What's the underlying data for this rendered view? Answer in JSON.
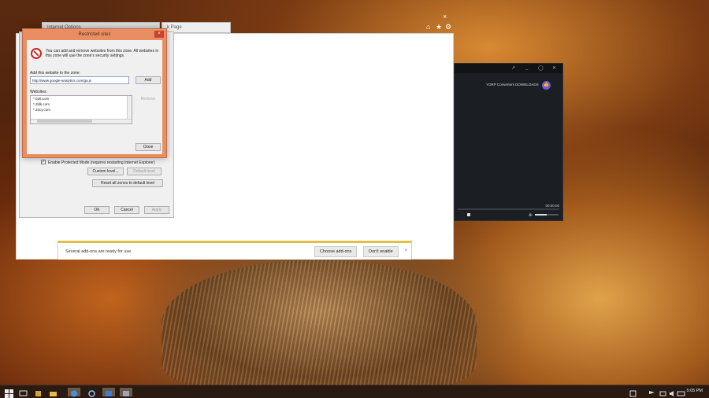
{
  "background_tabs": {
    "tab1_label": "Internet Options",
    "tab2_label": "k Page"
  },
  "browser_controls": {
    "close_glyph": "×",
    "home_glyph": "⌂",
    "star_glyph": "★",
    "gear_glyph": "⚙"
  },
  "notification": {
    "message": "Several add-ons are ready for use.",
    "choose_label": "Choose add-ons",
    "dont_enable_label": "Don't enable",
    "close_glyph": "×"
  },
  "media_player": {
    "window_buttons": [
      "↗",
      "_",
      "◯",
      "✕"
    ],
    "track_title": "YORP Converters DOWNLOADS",
    "time": "00:00:00",
    "volume_level": 0.5,
    "colors": {
      "background": "#1b1e22",
      "accent": "#6f5bd6"
    }
  },
  "internet_options": {
    "protected_mode_checked": true,
    "protected_mode_label": "Enable Protected Mode (requires restarting Internet Explorer)",
    "custom_level_label": "Custom level...",
    "default_level_label": "Default level",
    "reset_all_label": "Reset all zones to default level",
    "ok_label": "OK",
    "cancel_label": "Cancel",
    "apply_label": "Apply"
  },
  "restricted_sites": {
    "title": "Restricted sites",
    "close_glyph": "×",
    "description_line1": "You can add and remove websites from this zone. All websites in",
    "description_line2": "this zone will use the zone's security settings.",
    "add_label_text": "Add this website to the zone:",
    "input_value": "http://www.google-analytics.com/ga.js",
    "add_button": "Add",
    "websites_label": "Websites:",
    "remove_button": "Remove",
    "websites": [
      "*.028.com",
      "*.2ldk.com",
      "*.33cy.com"
    ],
    "close_button": "Close",
    "colors": {
      "frame": "#e88e62",
      "close": "#c7432f"
    }
  },
  "taskbar": {
    "clock": "5:05 PM",
    "icons": [
      "start-icon",
      "search-icon",
      "task-view-icon",
      "file-explorer-icon",
      "chrome-icon",
      "ie-icon",
      "store-icon"
    ],
    "tray_icons": [
      "notification-icon",
      "network-icon",
      "volume-icon",
      "keyboard-icon"
    ]
  }
}
